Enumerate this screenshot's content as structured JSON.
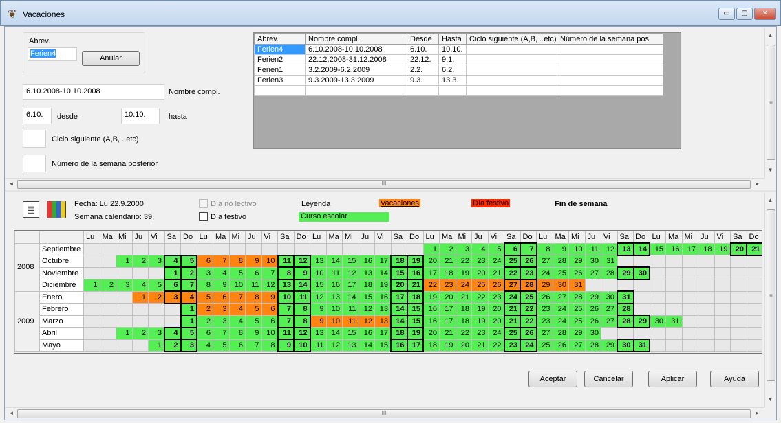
{
  "window": {
    "title": "Vacaciones",
    "minimize": "▭",
    "maximize": "▢",
    "close": "✕"
  },
  "form": {
    "abrev_label": "Abrev.",
    "abrev_value": "Ferien4",
    "cancel_button": "Anular",
    "full_name_value": "6.10.2008-10.10.2008",
    "full_name_label": "Nombre compl.",
    "from_value": "6.10.",
    "from_label": "desde",
    "to_value": "10.10.",
    "to_label": "hasta",
    "next_cycle_label": "Ciclo siguiente (A,B, ..etc)",
    "next_week_label": "Número de la semana posterior"
  },
  "holidays": {
    "headers": [
      "Abrev.",
      "Nombre compl.",
      "Desde",
      "Hasta",
      "Ciclo siguiente (A,B, ..etc)",
      "Número de la semana pos"
    ],
    "rows": [
      [
        "Ferien4",
        "6.10.2008-10.10.2008",
        "6.10.",
        "10.10.",
        "",
        ""
      ],
      [
        "Ferien2",
        "22.12.2008-31.12.2008",
        "22.12.",
        "9.1.",
        "",
        ""
      ],
      [
        "Ferien1",
        "3.2.2009-6.2.2009",
        "2.2.",
        "6.2.",
        "",
        ""
      ],
      [
        "Ferien3",
        "9.3.2009-13.3.2009",
        "9.3.",
        "13.3.",
        "",
        ""
      ]
    ]
  },
  "calendar_header": {
    "date_text": "Fecha: Lu 22.9.2000",
    "week_text": "Semana calendario: 39,",
    "non_school_day": "Día no lectivo",
    "holiday_day": "Día festivo",
    "legend_label": "Leyenda",
    "legend_vacation": "Vacaciones",
    "legend_holiday": "Día festivo",
    "legend_weekend": "Fin de semana",
    "legend_school": "Curso escolar",
    "colors": {
      "vacation": "#ff8411",
      "holiday": "#ff2a00",
      "school": "#55ee55"
    }
  },
  "calendar": {
    "day_headers": [
      "Lu",
      "Ma",
      "Mi",
      "Ju",
      "Vi",
      "Sa",
      "Do",
      "Lu",
      "Ma",
      "Mi",
      "Ju",
      "Vi",
      "Sa",
      "Do",
      "Lu",
      "Ma",
      "Mi",
      "Ju",
      "Vi",
      "Sa",
      "Do",
      "Lu",
      "Ma",
      "Mi",
      "Ju",
      "Vi",
      "Sa",
      "Do",
      "Lu",
      "Ma",
      "Mi",
      "Ju",
      "Vi",
      "Sa",
      "Do",
      "Lu",
      "Ma",
      "Mi",
      "Ju",
      "Vi",
      "Sa",
      "Do"
    ],
    "years": [
      {
        "year": "2008",
        "months": [
          {
            "name": "Septiembre",
            "start": 21,
            "days": 30,
            "vacation": []
          },
          {
            "name": "Octubre",
            "start": 2,
            "days": 31,
            "vacation": [
              6,
              7,
              8,
              9,
              10
            ]
          },
          {
            "name": "Noviembre",
            "start": 5,
            "days": 30,
            "vacation": []
          },
          {
            "name": "Diciembre",
            "start": 0,
            "days": 31,
            "vacation": [
              22,
              23,
              24,
              25,
              26,
              27,
              28,
              29,
              30,
              31
            ]
          }
        ]
      },
      {
        "year": "2009",
        "months": [
          {
            "name": "Enero",
            "start": 3,
            "days": 31,
            "vacation": [
              1,
              2,
              3,
              4,
              5,
              6,
              7,
              8,
              9
            ]
          },
          {
            "name": "Febrero",
            "start": 6,
            "days": 28,
            "vacation": [
              2,
              3,
              4,
              5,
              6
            ]
          },
          {
            "name": "Marzo",
            "start": 6,
            "days": 31,
            "vacation": [
              9,
              10,
              11,
              12,
              13
            ]
          },
          {
            "name": "Abril",
            "start": 2,
            "days": 30,
            "vacation": []
          },
          {
            "name": "Mayo",
            "start": 4,
            "days": 31,
            "vacation": []
          }
        ]
      }
    ]
  },
  "footer": {
    "accept": "Aceptar",
    "cancel": "Cancelar",
    "apply": "Aplicar",
    "help": "Ayuda"
  },
  "scroll": {
    "up": "▲",
    "down": "▼",
    "left": "◄",
    "right": "►",
    "grip": "≡",
    "grip_h": "III"
  }
}
